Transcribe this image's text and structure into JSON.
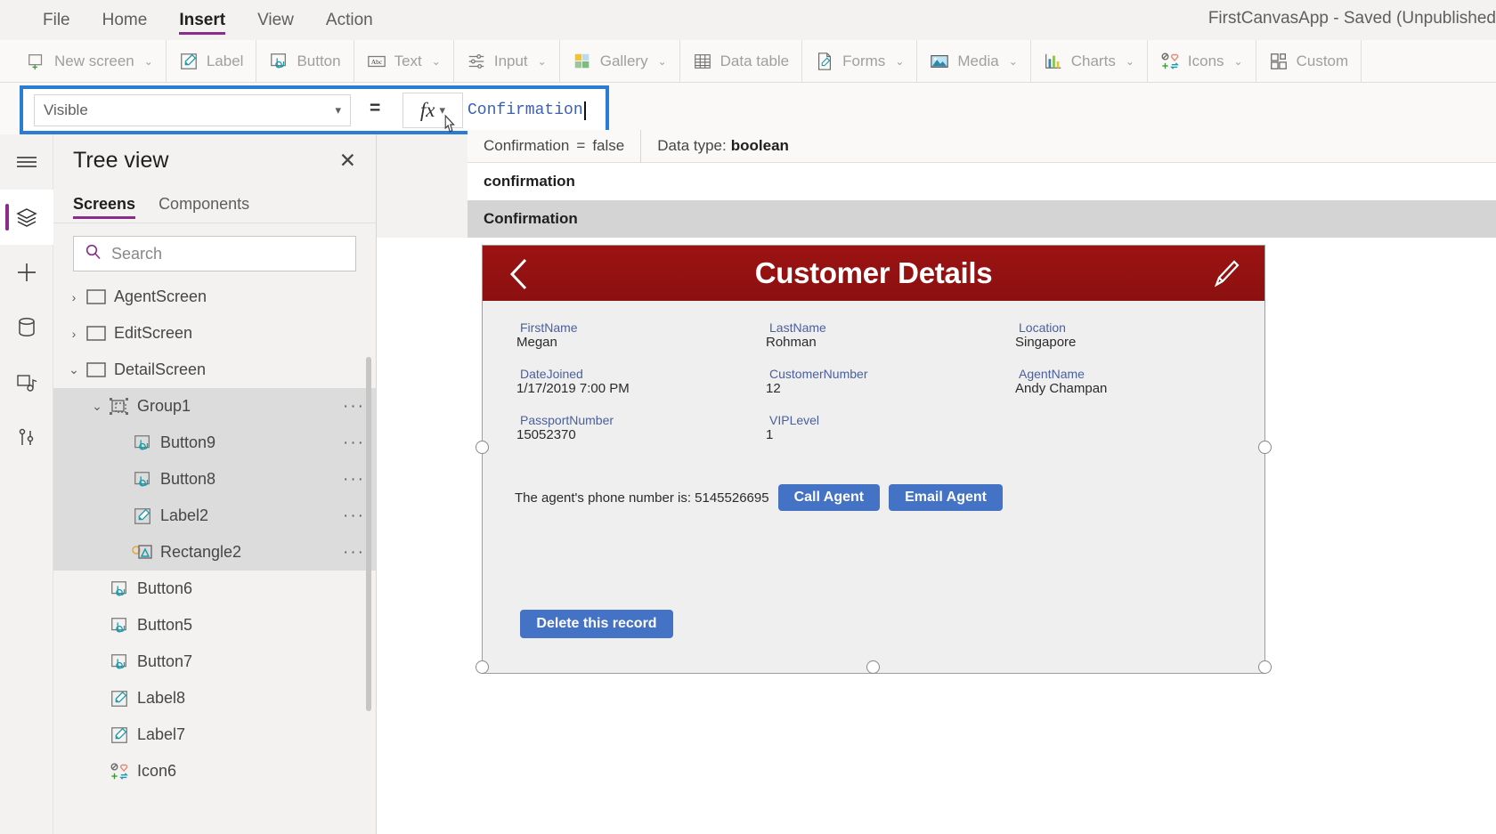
{
  "menu": {
    "items": [
      {
        "label": "File",
        "active": false
      },
      {
        "label": "Home",
        "active": false
      },
      {
        "label": "Insert",
        "active": true
      },
      {
        "label": "View",
        "active": false
      },
      {
        "label": "Action",
        "active": false
      }
    ],
    "app_title": "FirstCanvasApp - Saved (Unpublished"
  },
  "ribbon": {
    "groups": [
      {
        "label": "New screen",
        "icon": "new-screen-icon",
        "chevron": true
      },
      {
        "label": "Label",
        "icon": "label-icon",
        "chevron": false
      },
      {
        "label": "Button",
        "icon": "button-icon",
        "chevron": false
      },
      {
        "label": "Text",
        "icon": "text-icon",
        "chevron": true
      },
      {
        "label": "Input",
        "icon": "input-icon",
        "chevron": true
      },
      {
        "label": "Gallery",
        "icon": "gallery-icon",
        "chevron": true
      },
      {
        "label": "Data table",
        "icon": "data-table-icon",
        "chevron": false
      },
      {
        "label": "Forms",
        "icon": "forms-icon",
        "chevron": true
      },
      {
        "label": "Media",
        "icon": "media-icon",
        "chevron": true
      },
      {
        "label": "Charts",
        "icon": "charts-icon",
        "chevron": true
      },
      {
        "label": "Icons",
        "icon": "icons-icon",
        "chevron": true
      },
      {
        "label": "Custom",
        "icon": "custom-icon",
        "chevron": false
      }
    ]
  },
  "formula_bar": {
    "property": "Visible",
    "equals": "=",
    "fx": "fx",
    "formula": "Confirmation",
    "info": {
      "expression_name": "Confirmation",
      "equals_sign": "=",
      "value": "false",
      "data_type_label": "Data type:",
      "data_type_value": "boolean"
    },
    "suggestions": [
      {
        "label": "confirmation",
        "highlighted": false
      },
      {
        "label": "Confirmation",
        "highlighted": true
      }
    ]
  },
  "rail": {
    "items": [
      {
        "name": "hamburger-menu-icon",
        "active": false
      },
      {
        "name": "tree-view-icon",
        "active": true
      },
      {
        "name": "insert-add-icon",
        "active": false
      },
      {
        "name": "data-sources-icon",
        "active": false
      },
      {
        "name": "media-library-icon",
        "active": false
      },
      {
        "name": "advanced-tools-icon",
        "active": false
      }
    ]
  },
  "tree_view": {
    "title": "Tree view",
    "close": "✕",
    "tabs": [
      {
        "label": "Screens",
        "active": true
      },
      {
        "label": "Components",
        "active": false
      }
    ],
    "search_placeholder": "Search",
    "search_value": "",
    "items": [
      {
        "label": "AgentScreen",
        "indent": 0,
        "chevron": "›",
        "icon": "screen-icon",
        "selected": false,
        "dots": false
      },
      {
        "label": "EditScreen",
        "indent": 0,
        "chevron": "›",
        "icon": "screen-icon",
        "selected": false,
        "dots": false
      },
      {
        "label": "DetailScreen",
        "indent": 0,
        "chevron": "⌄",
        "icon": "screen-icon",
        "selected": false,
        "dots": false
      },
      {
        "label": "Group1",
        "indent": 1,
        "chevron": "⌄",
        "icon": "group-icon",
        "selected": true,
        "dots": true
      },
      {
        "label": "Button9",
        "indent": 2,
        "chevron": "",
        "icon": "button-icon",
        "selected": true,
        "dots": true
      },
      {
        "label": "Button8",
        "indent": 2,
        "chevron": "",
        "icon": "button-icon",
        "selected": true,
        "dots": true
      },
      {
        "label": "Label2",
        "indent": 2,
        "chevron": "",
        "icon": "label-icon",
        "selected": true,
        "dots": true
      },
      {
        "label": "Rectangle2",
        "indent": 2,
        "chevron": "",
        "icon": "rectangle-icon",
        "selected": true,
        "dots": true
      },
      {
        "label": "Button6",
        "indent": 1,
        "chevron": "",
        "icon": "button-icon",
        "selected": false,
        "dots": false
      },
      {
        "label": "Button5",
        "indent": 1,
        "chevron": "",
        "icon": "button-icon",
        "selected": false,
        "dots": false
      },
      {
        "label": "Button7",
        "indent": 1,
        "chevron": "",
        "icon": "button-icon",
        "selected": false,
        "dots": false
      },
      {
        "label": "Label8",
        "indent": 1,
        "chevron": "",
        "icon": "label-icon",
        "selected": false,
        "dots": false
      },
      {
        "label": "Label7",
        "indent": 1,
        "chevron": "",
        "icon": "label-icon",
        "selected": false,
        "dots": false
      },
      {
        "label": "Icon6",
        "indent": 1,
        "chevron": "",
        "icon": "icons-icon",
        "selected": false,
        "dots": false
      }
    ]
  },
  "canvas": {
    "app": {
      "header_title": "Customer Details",
      "header_color": "#9c1313",
      "back_icon": "back-chevron-icon",
      "edit_icon": "edit-pencil-icon",
      "fields": [
        {
          "label": "FirstName",
          "value": "Megan"
        },
        {
          "label": "LastName",
          "value": "Rohman"
        },
        {
          "label": "Location",
          "value": "Singapore"
        },
        {
          "label": "DateJoined",
          "value": "1/17/2019 7:00 PM"
        },
        {
          "label": "CustomerNumber",
          "value": "12"
        },
        {
          "label": "AgentName",
          "value": "Andy Champan"
        },
        {
          "label": "PassportNumber",
          "value": "15052370"
        },
        {
          "label": "VIPLevel",
          "value": "1"
        },
        {
          "label": "",
          "value": ""
        }
      ],
      "agent_phone_text": "The agent's phone number is: 5145526695",
      "call_agent_label": "Call Agent",
      "email_agent_label": "Email Agent",
      "delete_label": "Delete this record",
      "button_color": "#4472c4"
    }
  }
}
